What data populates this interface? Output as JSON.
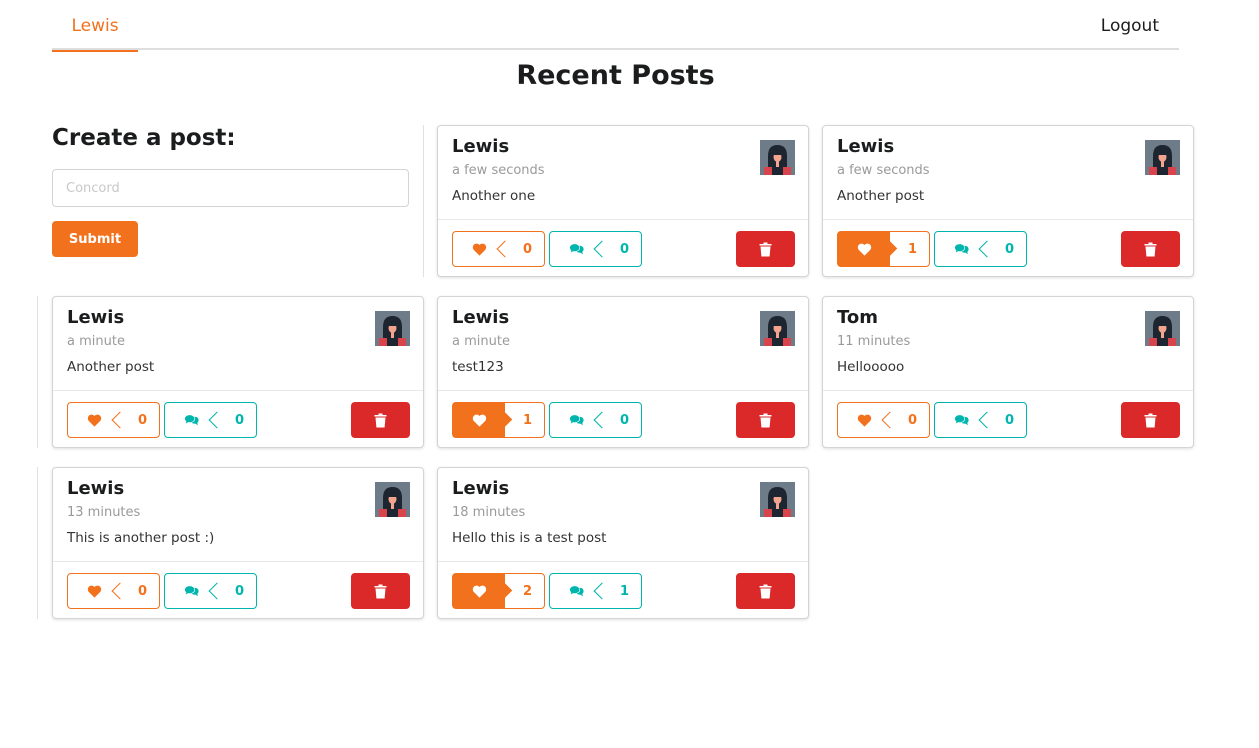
{
  "menu": {
    "active_item": "Lewis",
    "logout_label": "Logout"
  },
  "page": {
    "title": "Recent Posts"
  },
  "create_post": {
    "title": "Create a post:",
    "input_placeholder": "Concord",
    "input_value": "",
    "submit_label": "Submit"
  },
  "colors": {
    "accent": "#f2711c",
    "comment": "#00b5ad",
    "delete": "#db2828"
  },
  "icons": {
    "like": "heart-icon",
    "comment": "comments-icon",
    "delete": "trash-icon"
  },
  "posts": [
    {
      "author": "Lewis",
      "time": "a few seconds",
      "text": "Another one",
      "likes": "0",
      "liked": false,
      "comments": "0"
    },
    {
      "author": "Lewis",
      "time": "a few seconds",
      "text": "Another post",
      "likes": "1",
      "liked": true,
      "comments": "0"
    },
    {
      "author": "Lewis",
      "time": "a minute",
      "text": "Another post",
      "likes": "0",
      "liked": false,
      "comments": "0"
    },
    {
      "author": "Lewis",
      "time": "a minute",
      "text": "test123",
      "likes": "1",
      "liked": true,
      "comments": "0"
    },
    {
      "author": "Tom",
      "time": "11 minutes",
      "text": "Hellooooo",
      "likes": "0",
      "liked": false,
      "comments": "0"
    },
    {
      "author": "Lewis",
      "time": "13 minutes",
      "text": "This is another post :)",
      "likes": "0",
      "liked": false,
      "comments": "0"
    },
    {
      "author": "Lewis",
      "time": "18 minutes",
      "text": "Hello this is a test post",
      "likes": "2",
      "liked": true,
      "comments": "1"
    }
  ]
}
